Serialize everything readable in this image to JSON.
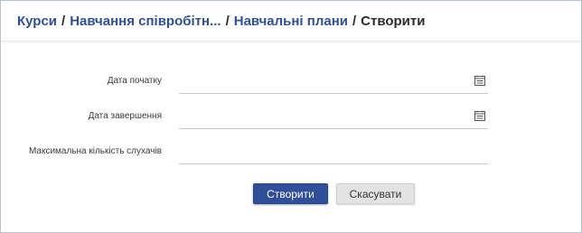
{
  "breadcrumb": {
    "items": [
      {
        "label": "Курси"
      },
      {
        "label": "Навчання співробітн..."
      },
      {
        "label": "Навчальні плани"
      }
    ],
    "separator": "/",
    "current": "Створити"
  },
  "form": {
    "start_date": {
      "label": "Дата початку",
      "value": "",
      "icon": "calendar-icon"
    },
    "end_date": {
      "label": "Дата завершення",
      "value": "",
      "icon": "calendar-icon"
    },
    "max_listeners": {
      "label": "Максимальна кількість слухачів",
      "value": ""
    }
  },
  "actions": {
    "create_label": "Створити",
    "cancel_label": "Скасувати"
  },
  "colors": {
    "accent": "#2f4f9a",
    "secondary_button": "#e3e3e3",
    "border": "#b9c3cf"
  }
}
